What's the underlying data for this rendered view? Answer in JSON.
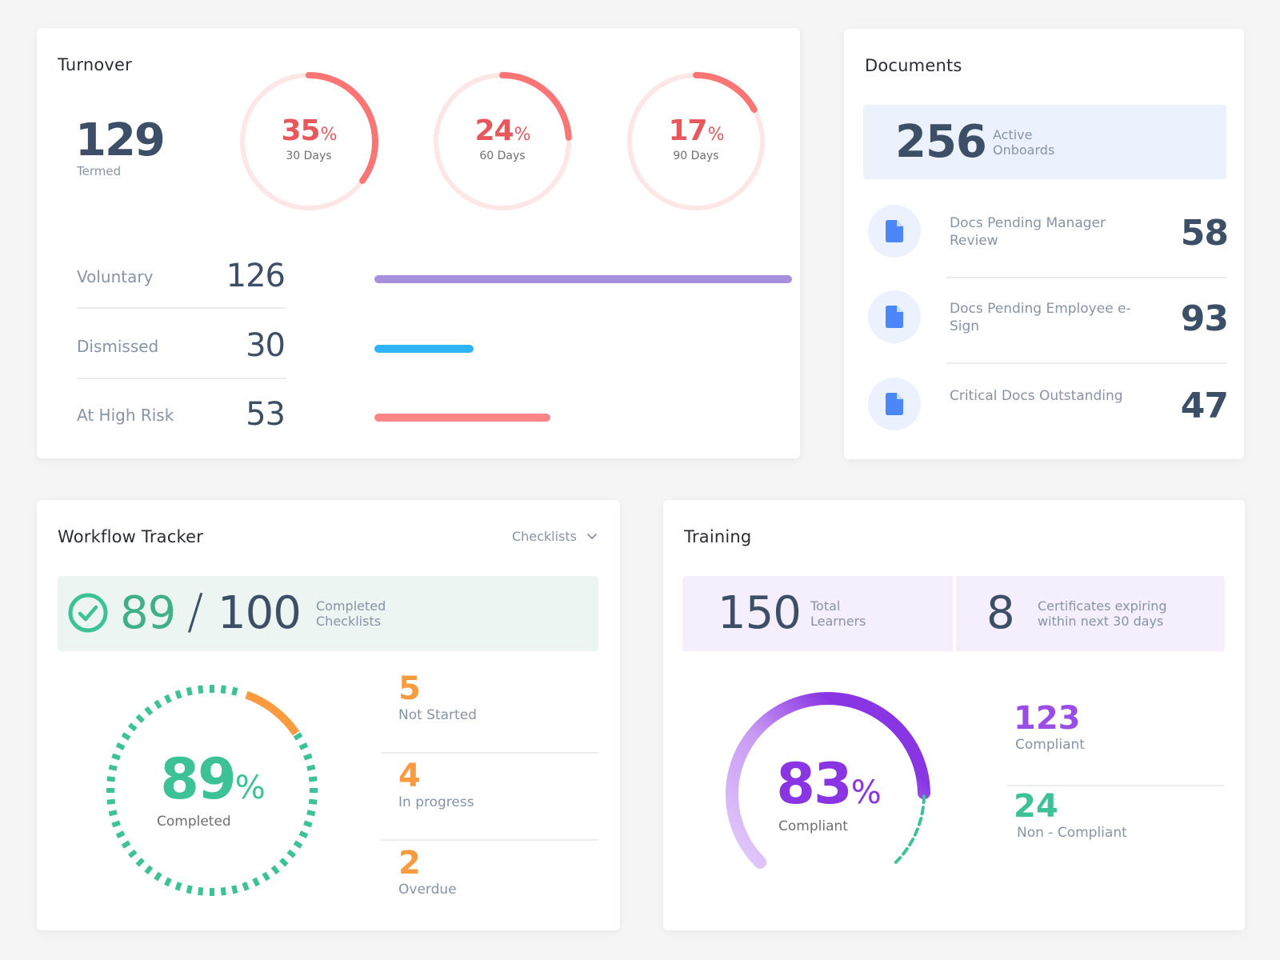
{
  "colors": {
    "ring_track": "#fde6e6",
    "ring_fill": "#fb7575",
    "voluntary": "#a690dc",
    "dismissed": "#2eb4f9",
    "high_risk": "#fd8585",
    "doc_icon": "#4b87f7",
    "workflow_green": "#3cc296",
    "workflow_orange": "#fa9b40",
    "training_purple": "#8a35e3",
    "training_light": "#e2ccfb",
    "training_green": "#3cc296"
  },
  "turnover": {
    "title": "Turnover",
    "termed_value": "129",
    "termed_label": "Termed",
    "rings": [
      {
        "value": "35",
        "percent": 35,
        "suffix": "%",
        "label": "30 Days"
      },
      {
        "value": "24",
        "percent": 24,
        "suffix": "%",
        "label": "60 Days"
      },
      {
        "value": "17",
        "percent": 17,
        "suffix": "%",
        "label": "90 Days"
      }
    ],
    "bars": [
      {
        "label": "Voluntary",
        "value": "126",
        "count": 126
      },
      {
        "label": "Dismissed",
        "value": "30",
        "count": 30
      },
      {
        "label": "At High Risk",
        "value": "53",
        "count": 53
      }
    ],
    "bar_max": 126
  },
  "documents": {
    "title": "Documents",
    "active_value": "256",
    "active_label_line1": "Active",
    "active_label_line2": "Onboards",
    "items": [
      {
        "icon": "document-icon",
        "label": "Docs Pending Manager Review",
        "value": "58"
      },
      {
        "icon": "document-icon",
        "label": "Docs Pending Employee e-Sign",
        "value": "93"
      },
      {
        "icon": "document-icon",
        "label": "Critical Docs Outstanding",
        "value": "47"
      }
    ]
  },
  "workflow": {
    "title": "Workflow Tracker",
    "dropdown_label": "Checklists",
    "completed": "89",
    "slash": "/",
    "total": "100",
    "banner_label_line1": "Completed",
    "banner_label_line2": "Checklists",
    "ring_value": "89",
    "ring_percent": 89,
    "ring_suffix": "%",
    "ring_label": "Completed",
    "stats": [
      {
        "value": "5",
        "label": "Not Started"
      },
      {
        "value": "4",
        "label": "In progress"
      },
      {
        "value": "2",
        "label": "Overdue"
      }
    ]
  },
  "training": {
    "title": "Training",
    "learners_value": "150",
    "learners_label_line1": "Total",
    "learners_label_line2": "Learners",
    "certs_value": "8",
    "certs_label_line1": "Certificates expiring",
    "certs_label_line2": "within next 30 days",
    "ring_value": "83",
    "ring_percent": 83,
    "ring_suffix": "%",
    "ring_label": "Compliant",
    "stats": [
      {
        "value": "123",
        "label": "Compliant"
      },
      {
        "value": "24",
        "label": "Non - Compliant"
      }
    ]
  }
}
